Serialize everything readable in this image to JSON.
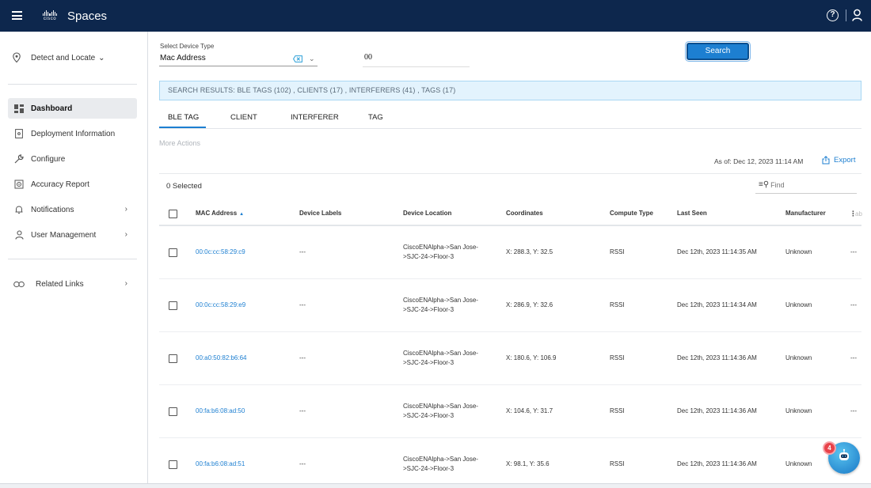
{
  "topbar": {
    "brand_word": "cisco",
    "app_title": "Spaces",
    "help_glyph": "?",
    "icons": [
      "hamburger-icon",
      "cisco-logo",
      "help-icon",
      "user-icon"
    ]
  },
  "sidebar": {
    "app_switcher": "Detect and Locate",
    "items": [
      {
        "label": "Dashboard",
        "icon": "dashboard-icon",
        "active": true
      },
      {
        "label": "Deployment Information",
        "icon": "deployment-icon"
      },
      {
        "label": "Configure",
        "icon": "wrench-icon"
      },
      {
        "label": "Accuracy Report",
        "icon": "target-icon"
      },
      {
        "label": "Notifications",
        "icon": "bell-icon",
        "chevron": true
      },
      {
        "label": "User Management",
        "icon": "user-icon",
        "chevron": true
      }
    ],
    "related_links": "Related Links"
  },
  "search": {
    "device_type_label": "Select Device Type",
    "device_type_value": "Mac Address",
    "mac_value": "00",
    "button_label": "Search"
  },
  "results_banner": "SEARCH RESULTS: BLE TAGS (102) , CLIENTS (17) , INTERFERERS (41) , TAGS (17)",
  "tabs": [
    {
      "label": "BLE TAG",
      "active": true
    },
    {
      "label": "CLIENT"
    },
    {
      "label": "INTERFERER"
    },
    {
      "label": "TAG"
    }
  ],
  "toolbar": {
    "more_actions": "More Actions",
    "as_of": "As of: Dec 12, 2023 11:14 AM",
    "export_label": "Export",
    "selected_count": "0 Selected",
    "find_placeholder": "Find"
  },
  "table": {
    "columns": [
      "MAC Address",
      "Device Labels",
      "Device Location",
      "Coordinates",
      "Compute Type",
      "Last Seen",
      "Manufacturer"
    ],
    "sort_indicator": "▲",
    "rows": [
      {
        "mac": "00:0c:cc:58:29:c9",
        "labels": "---",
        "location_1": "CiscoENAlpha->San Jose-",
        "location_2": ">SJC-24->Floor-3",
        "coords": "X: 288.3, Y: 32.5",
        "compute": "RSSI",
        "last_seen": "Dec 12th, 2023 11:14:35 AM",
        "manufacturer": "Unknown",
        "extra": "---"
      },
      {
        "mac": "00:0c:cc:58:29:e9",
        "labels": "---",
        "location_1": "CiscoENAlpha->San Jose-",
        "location_2": ">SJC-24->Floor-3",
        "coords": "X: 286.9, Y: 32.6",
        "compute": "RSSI",
        "last_seen": "Dec 12th, 2023 11:14:34 AM",
        "manufacturer": "Unknown",
        "extra": "---"
      },
      {
        "mac": "00:a0:50:82:b6:64",
        "labels": "---",
        "location_1": "CiscoENAlpha->San Jose-",
        "location_2": ">SJC-24->Floor-3",
        "coords": "X: 180.6, Y: 106.9",
        "compute": "RSSI",
        "last_seen": "Dec 12th, 2023 11:14:36 AM",
        "manufacturer": "Unknown",
        "extra": "---"
      },
      {
        "mac": "00:fa:b6:08:ad:50",
        "labels": "---",
        "location_1": "CiscoENAlpha->San Jose-",
        "location_2": ">SJC-24->Floor-3",
        "coords": "X: 104.6, Y: 31.7",
        "compute": "RSSI",
        "last_seen": "Dec 12th, 2023 11:14:36 AM",
        "manufacturer": "Unknown",
        "extra": "---"
      },
      {
        "mac": "00:fa:b6:08:ad:51",
        "labels": "---",
        "location_1": "CiscoENAlpha->San Jose-",
        "location_2": ">SJC-24->Floor-3",
        "coords": "X: 98.1, Y: 35.6",
        "compute": "RSSI",
        "last_seen": "Dec 12th, 2023 11:14:36 AM",
        "manufacturer": "Unknown",
        "extra": "---"
      }
    ]
  },
  "chatbot": {
    "badge_count": "4",
    "icon": "chatbot-icon"
  },
  "colors": {
    "topbar": "#0d274d",
    "accent": "#1d7fd1",
    "banner_bg": "#e3f3fd",
    "badge": "#e8424a"
  }
}
